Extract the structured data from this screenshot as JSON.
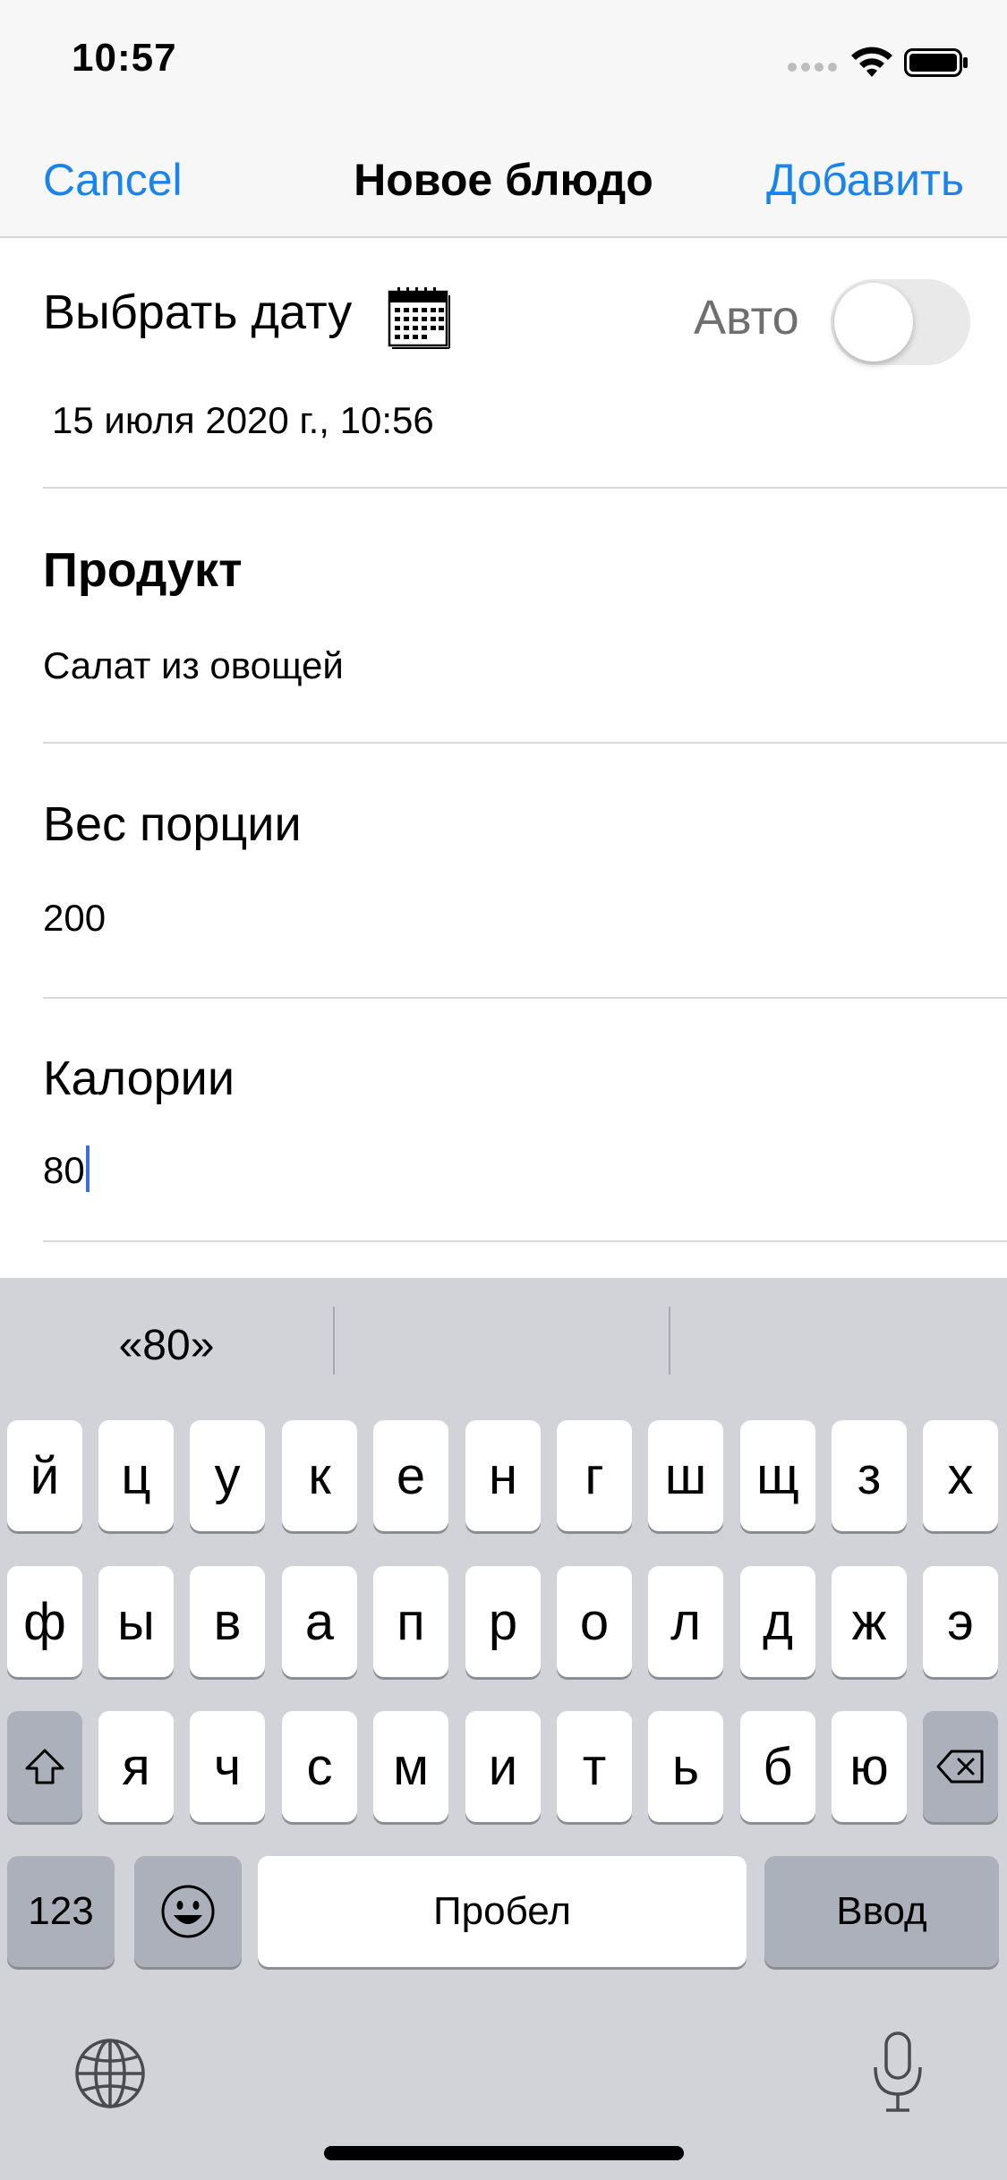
{
  "status": {
    "time": "10:57"
  },
  "nav": {
    "cancel": "Cancel",
    "title": "Новое блюдо",
    "add": "Добавить"
  },
  "date_section": {
    "label": "Выбрать дату",
    "auto_label": "Авто",
    "auto_toggle_on": false,
    "value": "15 июля 2020 г., 10:56"
  },
  "product": {
    "label": "Продукт",
    "value": "Салат из овощей"
  },
  "weight": {
    "label": "Вес порции",
    "value": "200"
  },
  "calories": {
    "label": "Калории",
    "value": "80"
  },
  "keyboard": {
    "suggestions": [
      "«80»",
      "",
      ""
    ],
    "row1": [
      "й",
      "ц",
      "у",
      "к",
      "е",
      "н",
      "г",
      "ш",
      "щ",
      "з",
      "х"
    ],
    "row2": [
      "ф",
      "ы",
      "в",
      "а",
      "п",
      "р",
      "о",
      "л",
      "д",
      "ж",
      "э"
    ],
    "row3": [
      "я",
      "ч",
      "с",
      "м",
      "и",
      "т",
      "ь",
      "б",
      "ю"
    ],
    "numbers_key": "123",
    "space": "Пробел",
    "return": "Ввод"
  },
  "colors": {
    "accent": "#1a84ea",
    "keyboard_bg": "#d1d3d9",
    "cursor": "#3b6fe0"
  }
}
